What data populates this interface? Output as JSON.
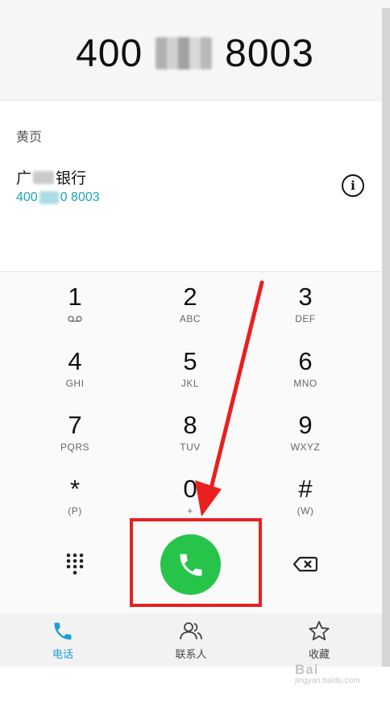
{
  "display": {
    "number_prefix": "400",
    "number_suffix": "8003"
  },
  "yellow_pages": {
    "header": "黄页",
    "name_prefix": "广",
    "name_suffix": "银行",
    "phone_prefix": "400",
    "phone_suffix": "0 8003"
  },
  "keypad": {
    "keys": [
      {
        "digit": "1",
        "letters": ""
      },
      {
        "digit": "2",
        "letters": "ABC"
      },
      {
        "digit": "3",
        "letters": "DEF"
      },
      {
        "digit": "4",
        "letters": "GHI"
      },
      {
        "digit": "5",
        "letters": "JKL"
      },
      {
        "digit": "6",
        "letters": "MNO"
      },
      {
        "digit": "7",
        "letters": "PQRS"
      },
      {
        "digit": "8",
        "letters": "TUV"
      },
      {
        "digit": "9",
        "letters": "WXYZ"
      },
      {
        "digit": "*",
        "letters": "(P)"
      },
      {
        "digit": "0",
        "letters": "+"
      },
      {
        "digit": "#",
        "letters": "(W)"
      }
    ]
  },
  "icons": {
    "voicemail": "voicemail-icon",
    "dialpad": "dialpad-icon",
    "call": "phone-icon",
    "backspace": "backspace-icon",
    "info": "info-icon"
  },
  "bottom_nav": {
    "items": [
      {
        "label": "电话",
        "icon": "phone-icon",
        "active": true
      },
      {
        "label": "联系人",
        "icon": "contacts-icon",
        "active": false
      },
      {
        "label": "收藏",
        "icon": "star-icon",
        "active": false
      }
    ]
  },
  "watermark": {
    "text": "Bai",
    "sub": "jingyan.baidu.com"
  },
  "colors": {
    "call_green": "#27c44a",
    "accent_teal": "#1aa6b7",
    "nav_active": "#1a9fd6",
    "annotation_red": "#ea1f1f"
  }
}
